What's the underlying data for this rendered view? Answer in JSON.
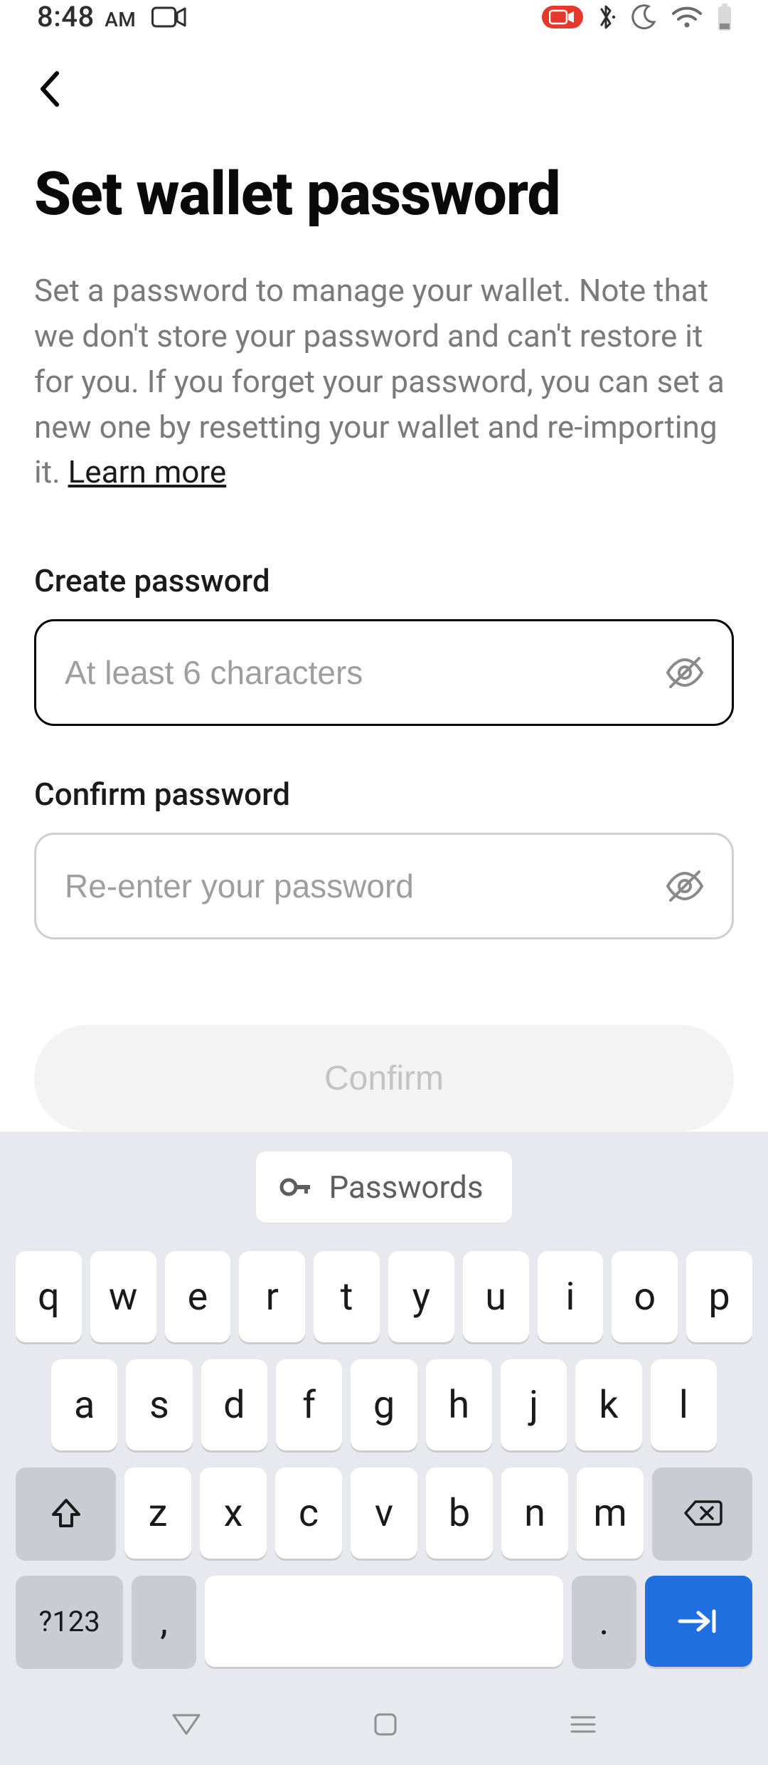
{
  "status": {
    "time": "8:48",
    "ampm": "AM",
    "icons": {
      "video": "video-icon",
      "recording": "recording-badge",
      "bluetooth": "bluetooth-icon",
      "dnd": "moon-icon",
      "wifi": "wifi-icon",
      "battery": "battery-icon"
    }
  },
  "header": {
    "back_icon": "chevron-left-icon"
  },
  "page": {
    "title": "Set wallet password",
    "description_text": "Set a password to manage your wallet. Note that we don't store your password and can't restore it for you. If you forget your password, you can set a new one by resetting your wallet and re-importing it. ",
    "learn_more_text": "Learn more"
  },
  "form": {
    "create": {
      "label": "Create password",
      "placeholder": "At least 6 characters",
      "value": "",
      "focused": true,
      "visibility_icon": "eye-off-icon"
    },
    "confirm": {
      "label": "Confirm password",
      "placeholder": "Re-enter your password",
      "value": "",
      "focused": false,
      "visibility_icon": "eye-off-icon"
    },
    "submit_label": "Confirm",
    "submit_enabled": false
  },
  "keyboard": {
    "suggestion": {
      "icon": "key-icon",
      "label": "Passwords"
    },
    "rows": {
      "r1": [
        "q",
        "w",
        "e",
        "r",
        "t",
        "y",
        "u",
        "i",
        "o",
        "p"
      ],
      "r2": [
        "a",
        "s",
        "d",
        "f",
        "g",
        "h",
        "j",
        "k",
        "l"
      ],
      "r3": [
        "z",
        "x",
        "c",
        "v",
        "b",
        "n",
        "m"
      ]
    },
    "shift_icon": "shift-icon",
    "backspace_icon": "backspace-icon",
    "symbols_label": "?123",
    "comma_label": ",",
    "period_label": ".",
    "enter_icon": "tab-arrow-icon"
  },
  "navbar": {
    "back_icon": "nav-back-icon",
    "home_icon": "nav-home-icon",
    "recents_icon": "nav-recents-icon"
  }
}
